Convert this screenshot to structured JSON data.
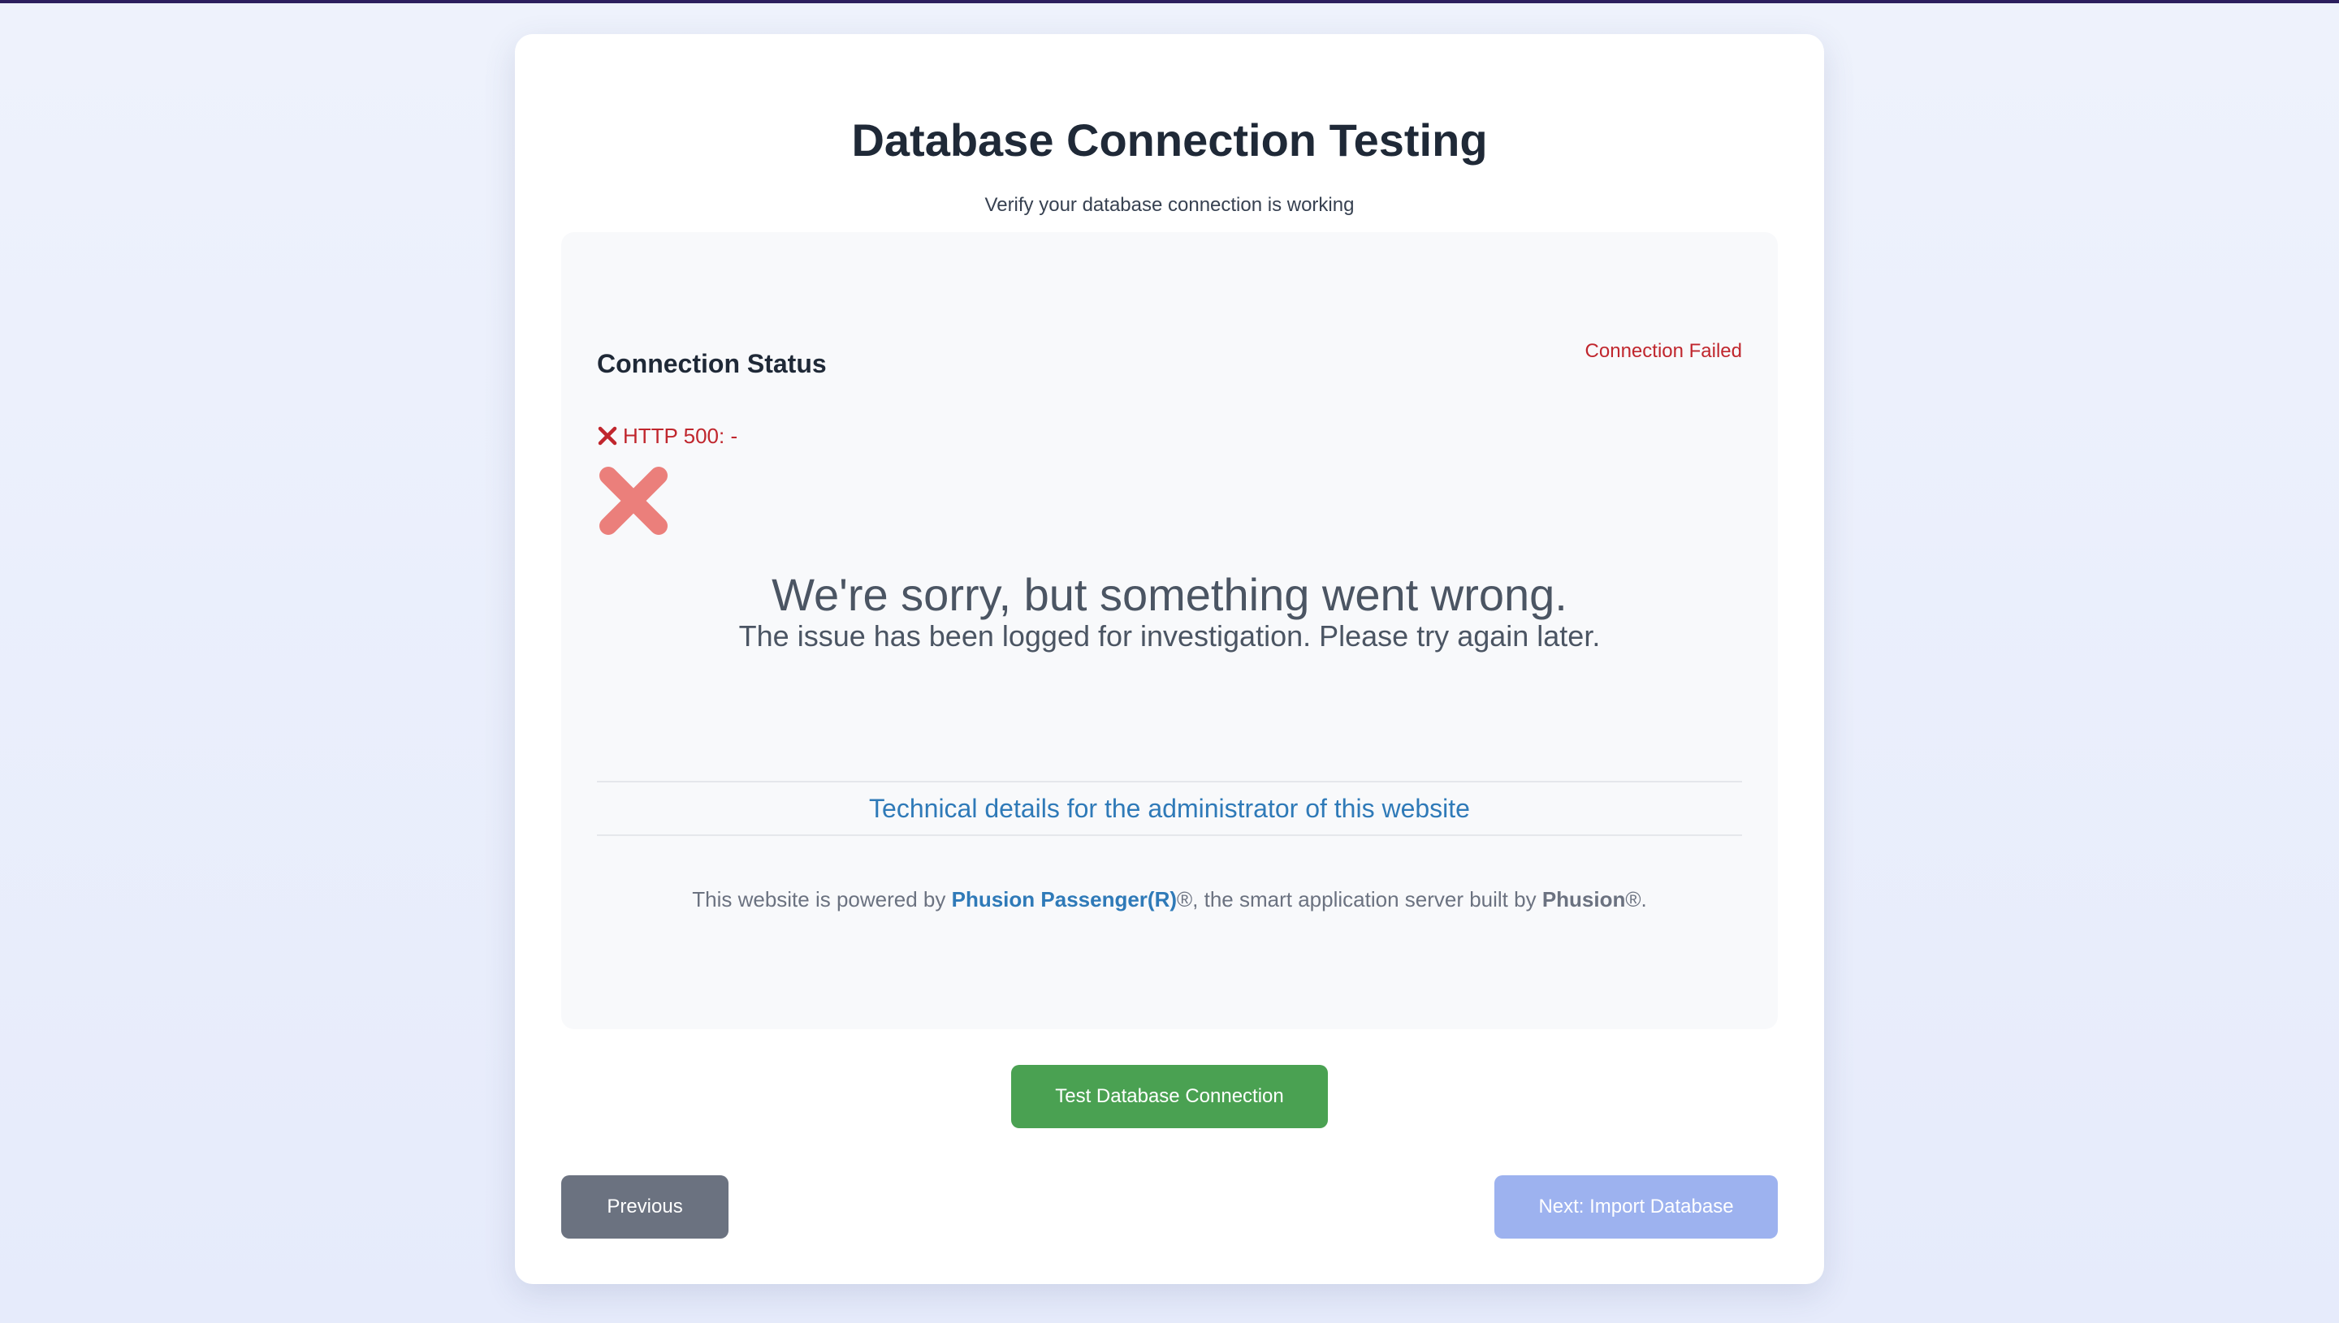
{
  "page": {
    "title": "Database Connection Testing",
    "subtitle": "Verify your database connection is working"
  },
  "status_panel": {
    "heading": "Connection Status",
    "status_text": "Connection Failed",
    "http_error": "HTTP 500: -",
    "error_page": {
      "headline": "We're sorry, but something went wrong.",
      "message": "The issue has been logged for investigation. Please try again later.",
      "details_link": "Technical details for the administrator of this website",
      "powered_prefix": "This website is powered by ",
      "powered_link": "Phusion Passenger(R)",
      "powered_middle": "®, the smart application server built by ",
      "powered_brand": "Phusion",
      "powered_suffix": "®."
    }
  },
  "buttons": {
    "test_connection": "Test Database Connection",
    "previous": "Previous",
    "next": "Next: Import Database"
  },
  "colors": {
    "error_red": "#c0262d",
    "error_icon": "#eb7f7b",
    "link_blue": "#2f7ab8",
    "test_button": "#4aa152",
    "previous_button": "#6b7280",
    "next_button_disabled": "#9db2ef"
  },
  "icons": {
    "http_error_icon": "close-x-icon",
    "error_page_icon": "large-x-icon"
  }
}
